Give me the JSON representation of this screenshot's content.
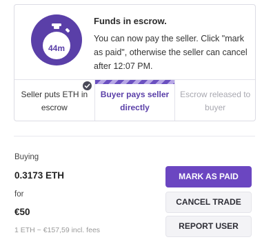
{
  "status": {
    "timer": "44m",
    "title": "Funds in escrow.",
    "message": "You can now pay the seller. Click \"mark as paid\", otherwise the seller can cancel after 12:07 PM."
  },
  "steps": [
    {
      "label": "Seller puts ETH in escrow",
      "state": "done"
    },
    {
      "label": "Buyer pays seller directly",
      "state": "active"
    },
    {
      "label": "Escrow released to buyer",
      "state": "pending"
    }
  ],
  "trade": {
    "buying_label": "Buying",
    "amount": "0.3173 ETH",
    "for_label": "for",
    "price": "€50",
    "rate": "1 ETH ~ €157,59 incl. fees"
  },
  "actions": {
    "mark_paid": "MARK AS PAID",
    "cancel": "CANCEL TRADE",
    "report": "REPORT USER"
  },
  "colors": {
    "accent": "#6b46c1",
    "accent_dark": "#5a3fa8"
  }
}
